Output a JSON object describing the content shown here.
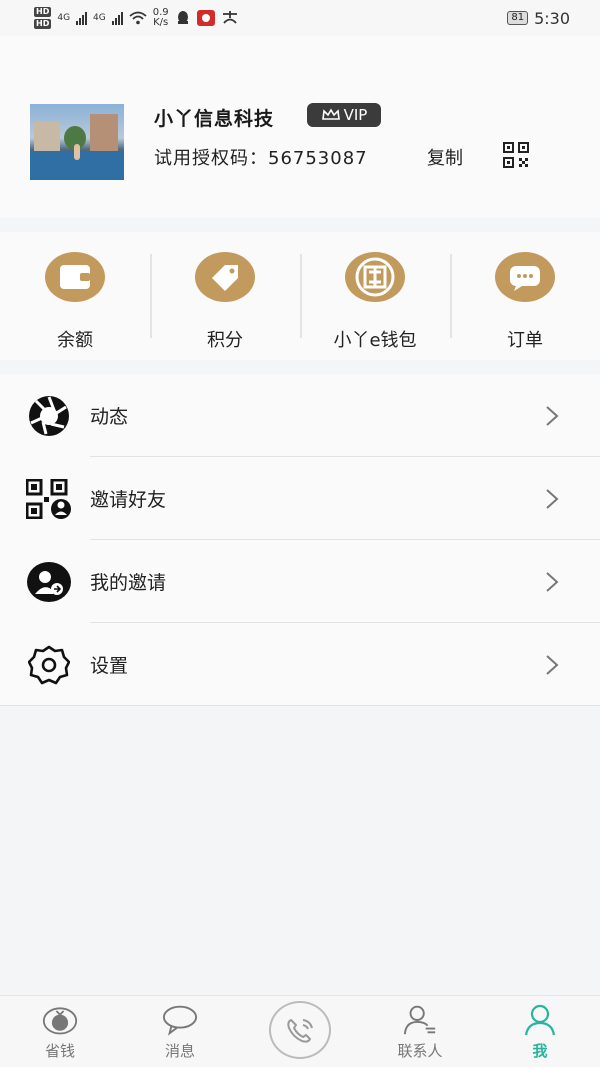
{
  "status_bar": {
    "hd1": "HD",
    "hd2": "HD",
    "net1": "4G",
    "net2": "4G",
    "speed_value": "0.9",
    "speed_unit": "K/s",
    "battery": "81",
    "time": "5:30"
  },
  "profile": {
    "company_name": "小丫信息科技",
    "vip_label": "VIP",
    "trial_code_label": "试用授权码：",
    "trial_code_value": "56753087",
    "copy_label": "复制"
  },
  "quick_actions": [
    {
      "label": "余额",
      "icon": "wallet-icon"
    },
    {
      "label": "积分",
      "icon": "tag-icon"
    },
    {
      "label": "小丫e钱包",
      "icon": "ecny-coin-icon"
    },
    {
      "label": "订单",
      "icon": "order-chat-icon"
    }
  ],
  "menu": [
    {
      "label": "动态",
      "icon": "aperture-icon"
    },
    {
      "label": "邀请好友",
      "icon": "qr-invite-icon"
    },
    {
      "label": "我的邀请",
      "icon": "my-invite-icon"
    },
    {
      "label": "设置",
      "icon": "settings-icon"
    }
  ],
  "tabbar": {
    "tabs": [
      {
        "label": "省钱",
        "icon": "money-bag-icon"
      },
      {
        "label": "消息",
        "icon": "chat-bubble-icon"
      },
      {
        "label": "联系人",
        "icon": "contacts-icon"
      },
      {
        "label": "我",
        "icon": "user-icon"
      }
    ],
    "active_index": 3,
    "center_icon": "phone-call-icon"
  },
  "colors": {
    "accent_gold": "#c39a5e",
    "active_tab": "#27b4a0",
    "vip_badge_bg": "#3b3b3b"
  }
}
